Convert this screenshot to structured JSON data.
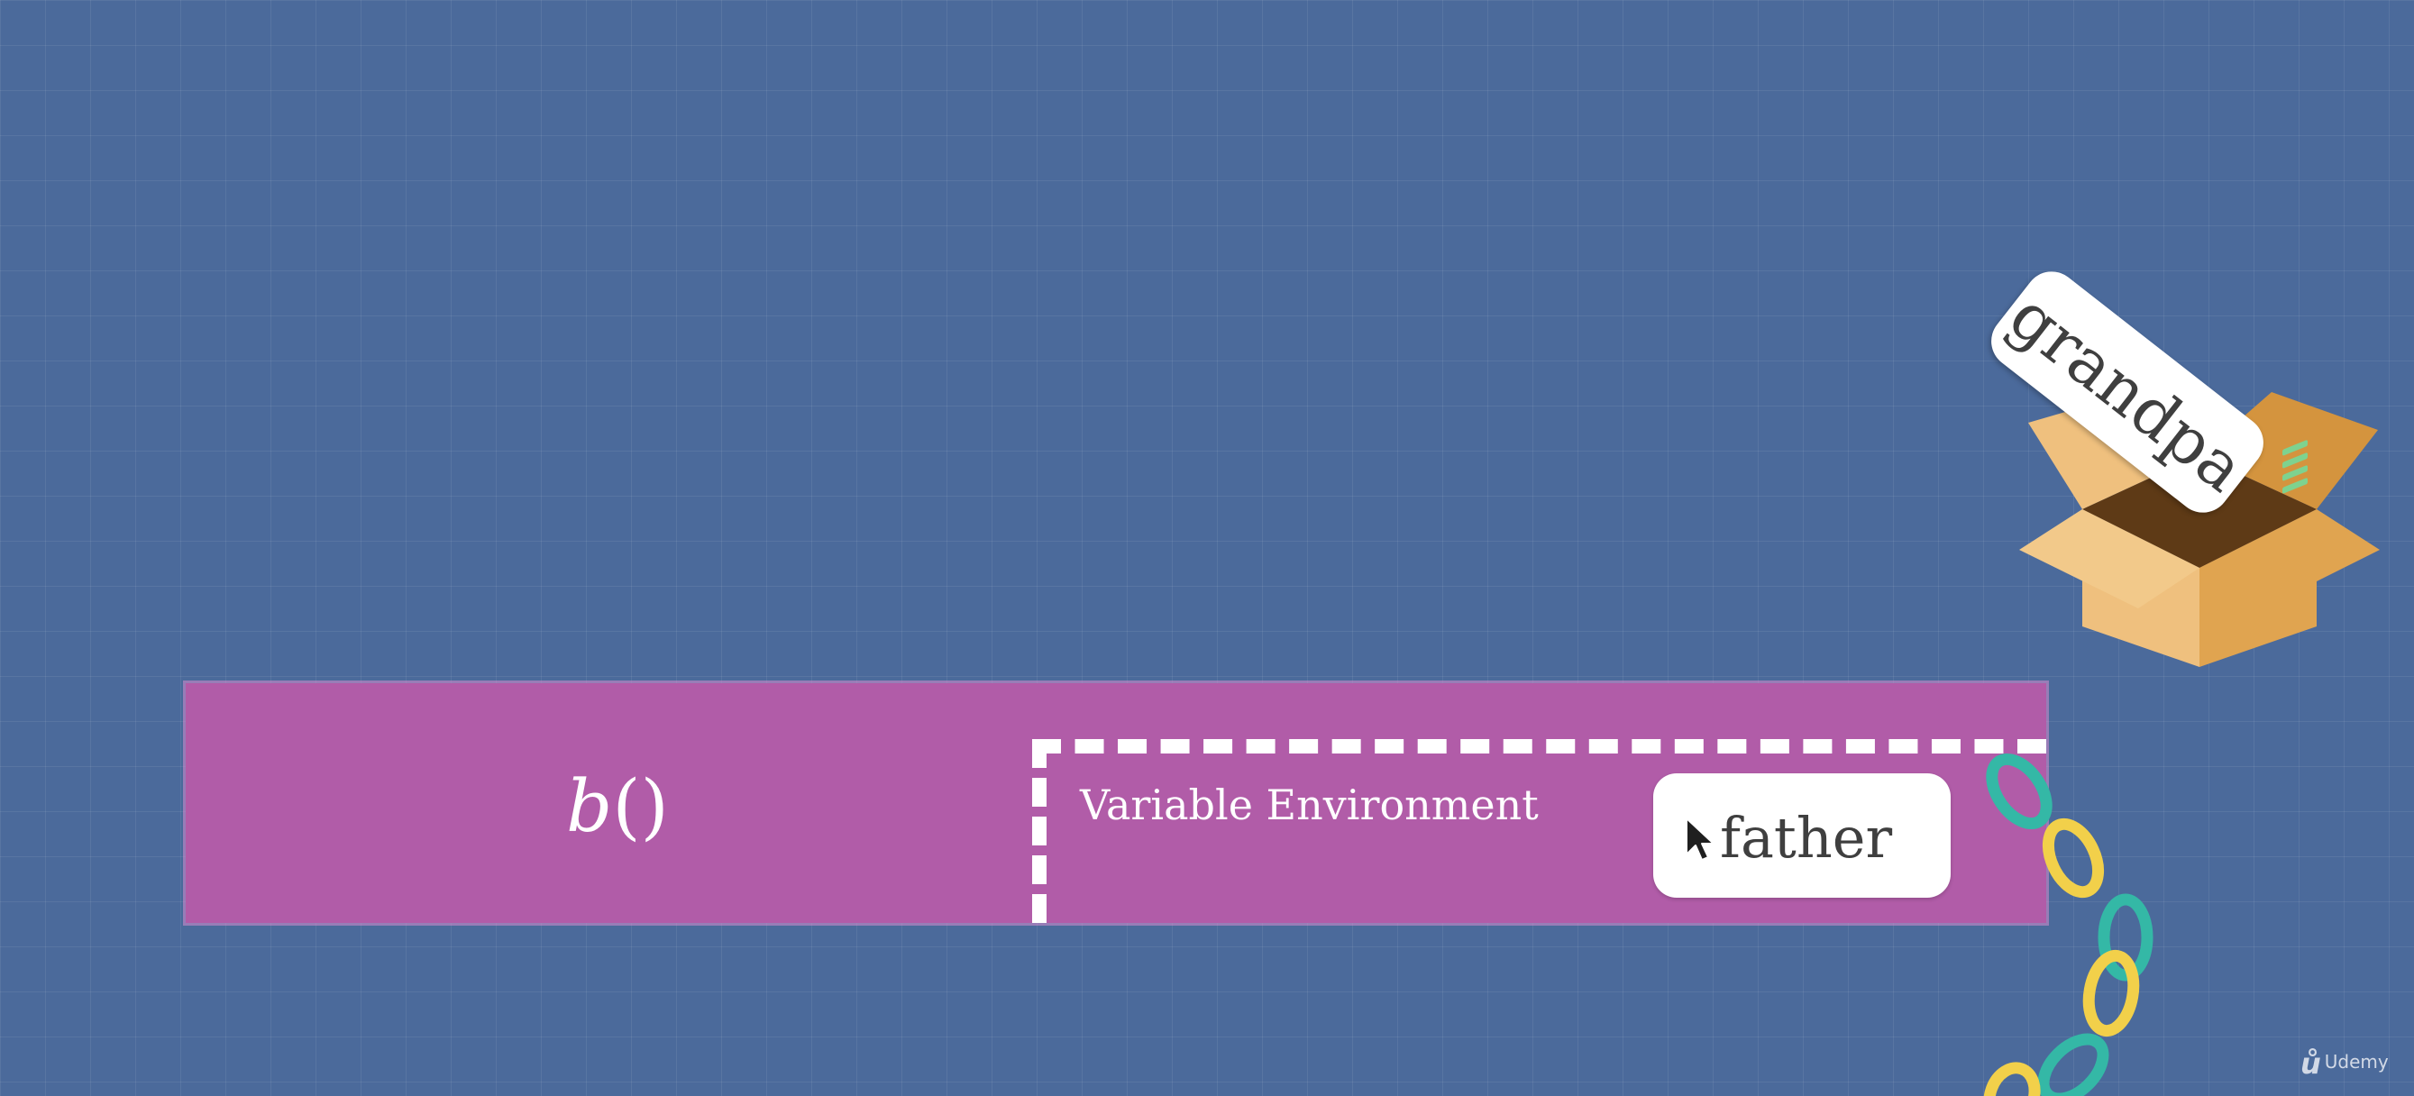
{
  "function_context": {
    "name": "b",
    "parens": "()"
  },
  "variable_environment": {
    "label": "Variable Environment",
    "item": "father"
  },
  "outer_environment": {
    "item": "grandpa"
  },
  "watermark": {
    "logo_icon": "udemy-logo-icon",
    "text": "Udemy"
  },
  "colors": {
    "background": "#4b6a9b",
    "context_bar": "#b15ca8",
    "box": "#e0a450",
    "chain_teal": "#34b8a6",
    "chain_yellow": "#f2d04a"
  }
}
